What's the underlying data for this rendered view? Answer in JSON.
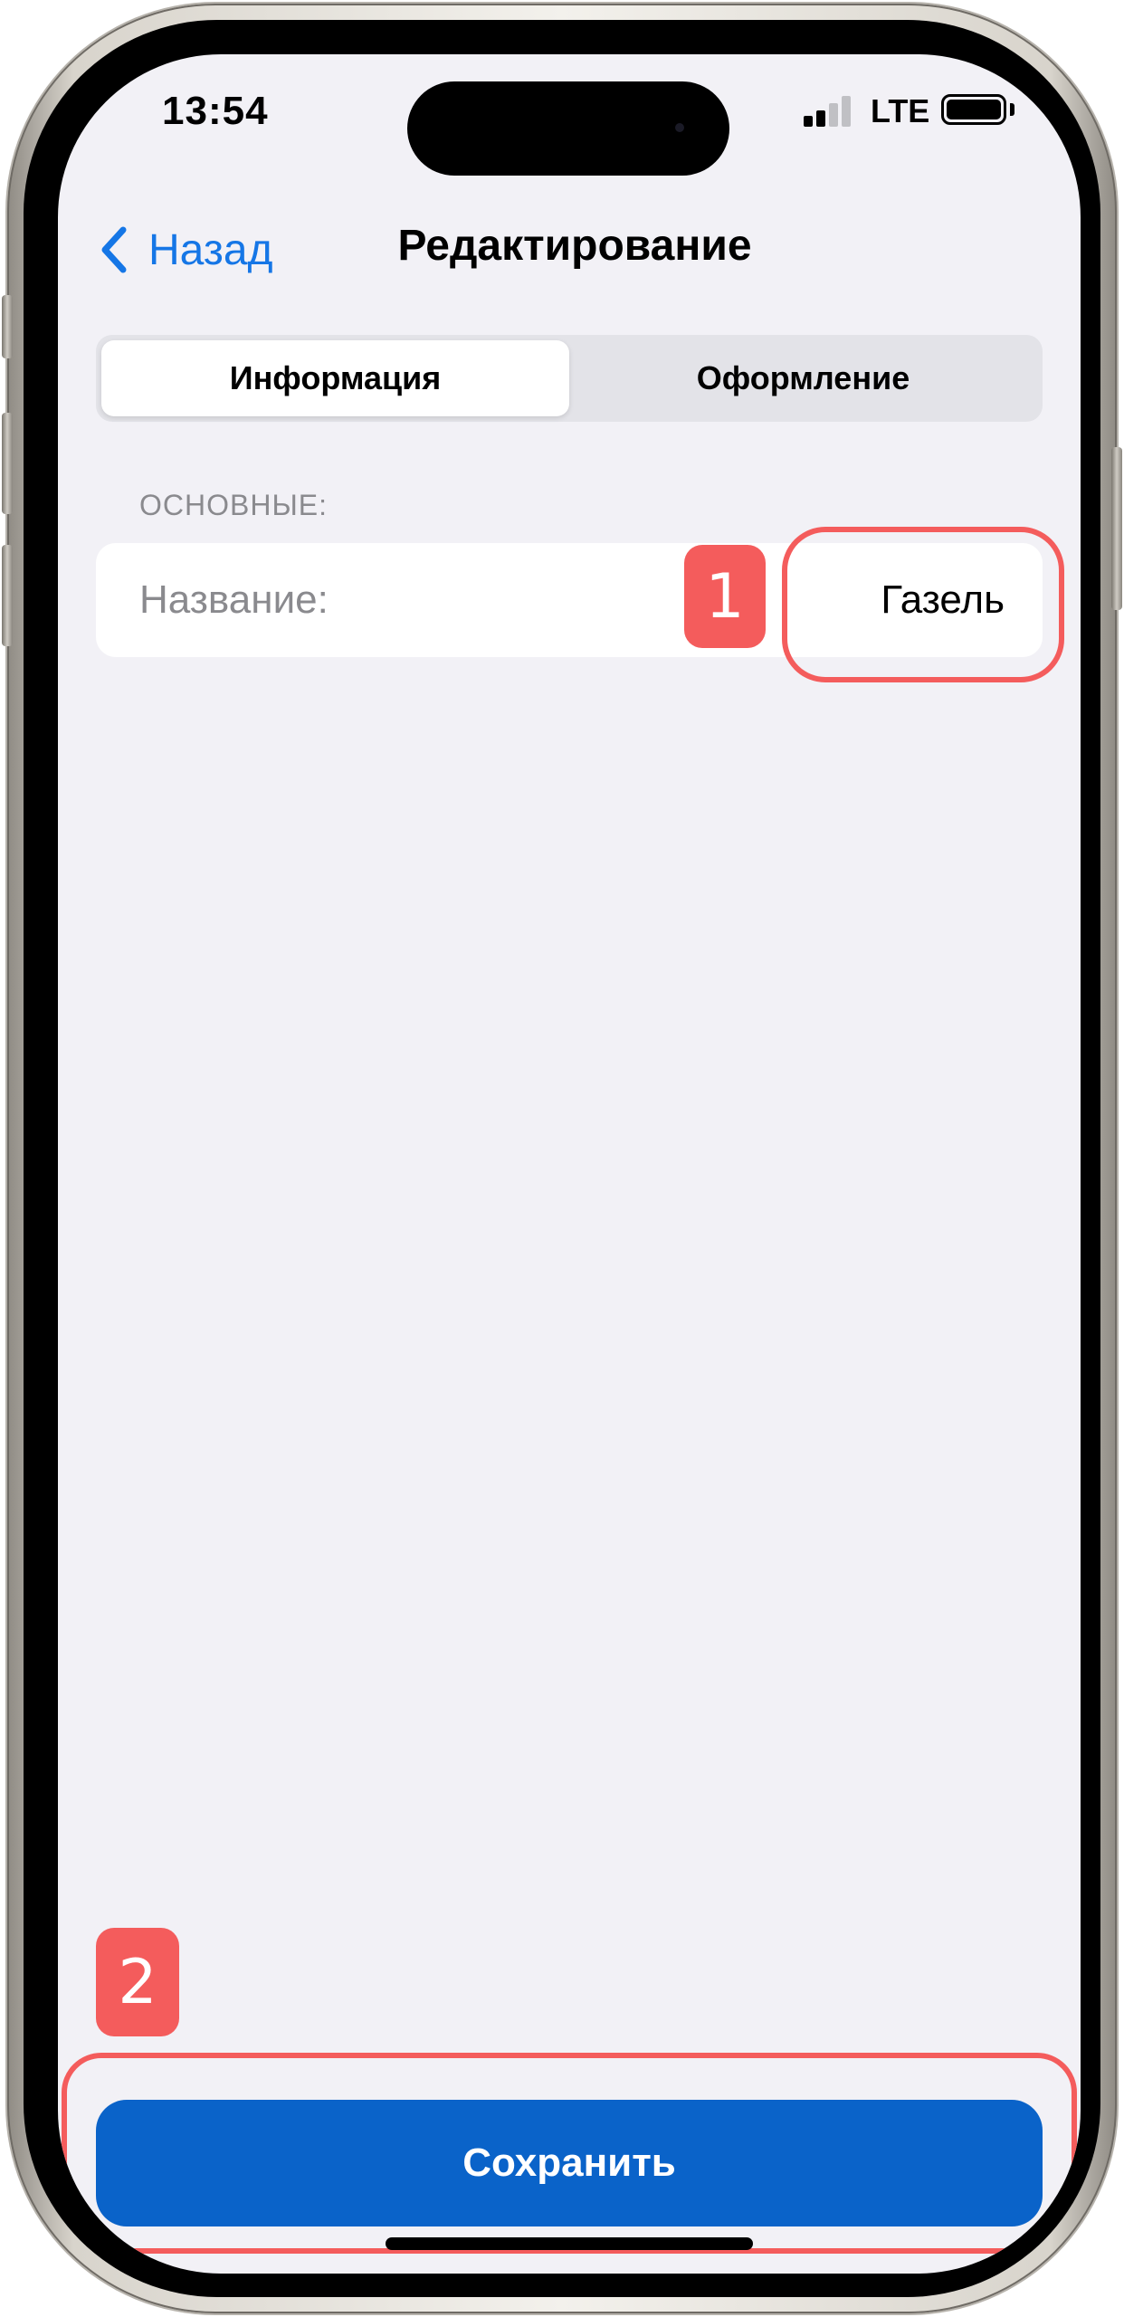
{
  "status_bar": {
    "time": "13:54",
    "network": "LTE",
    "signal_bars_active": 2,
    "signal_bars_total": 4,
    "battery_level": 1.0
  },
  "nav": {
    "back_label": "Назад",
    "title": "Редактирование"
  },
  "tabs": [
    {
      "label": "Информация",
      "active": true
    },
    {
      "label": "Оформление",
      "active": false
    }
  ],
  "section": {
    "header": "ОСНОВНЫЕ:",
    "field_label": "Название:",
    "field_value": "Газель"
  },
  "annotations": {
    "marker_1": "1",
    "marker_2": "2",
    "marker_color": "#f45c5c"
  },
  "save_button": {
    "label": "Сохранить",
    "color": "#0a63c9"
  },
  "colors": {
    "accent": "#1576e6",
    "background": "#f2f1f6"
  }
}
